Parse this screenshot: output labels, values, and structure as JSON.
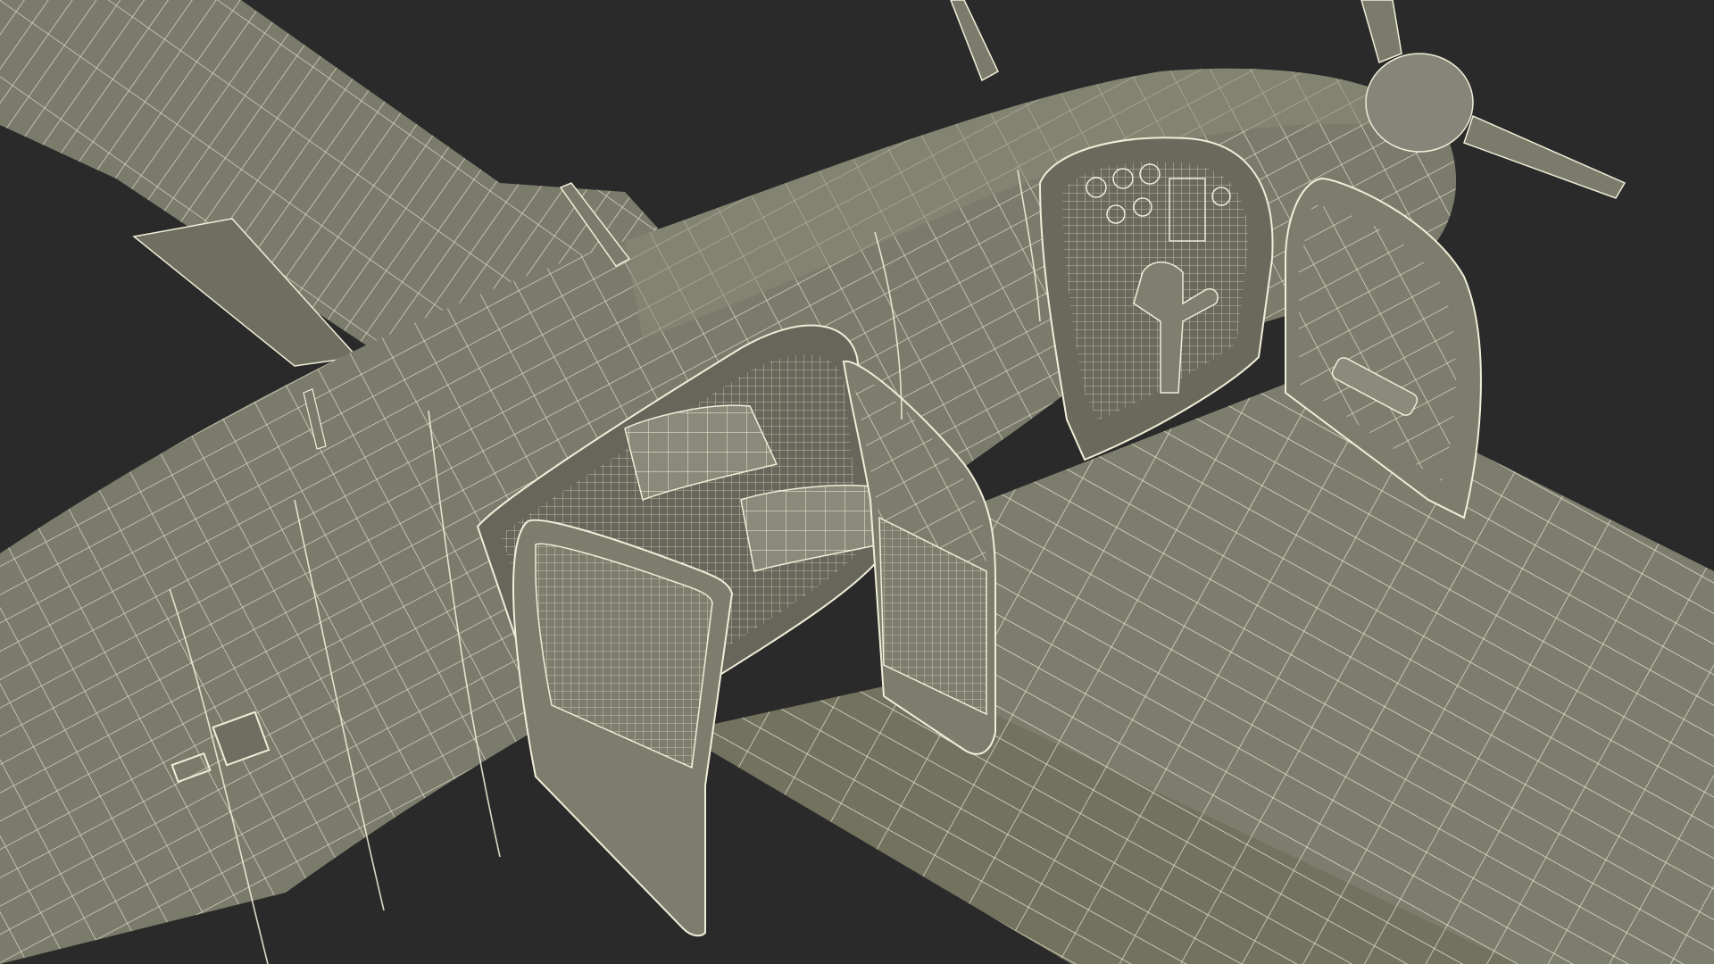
{
  "scene": {
    "subject": "twin-engine-aircraft-wireframe-model",
    "colors": {
      "background": "#2a2a2a",
      "surface": "#7b7b6c",
      "surface_dark": "#5f5f52",
      "surface_light": "#8e8e7e",
      "interior": "#6f6f61",
      "wire": "#f0eed8"
    }
  }
}
